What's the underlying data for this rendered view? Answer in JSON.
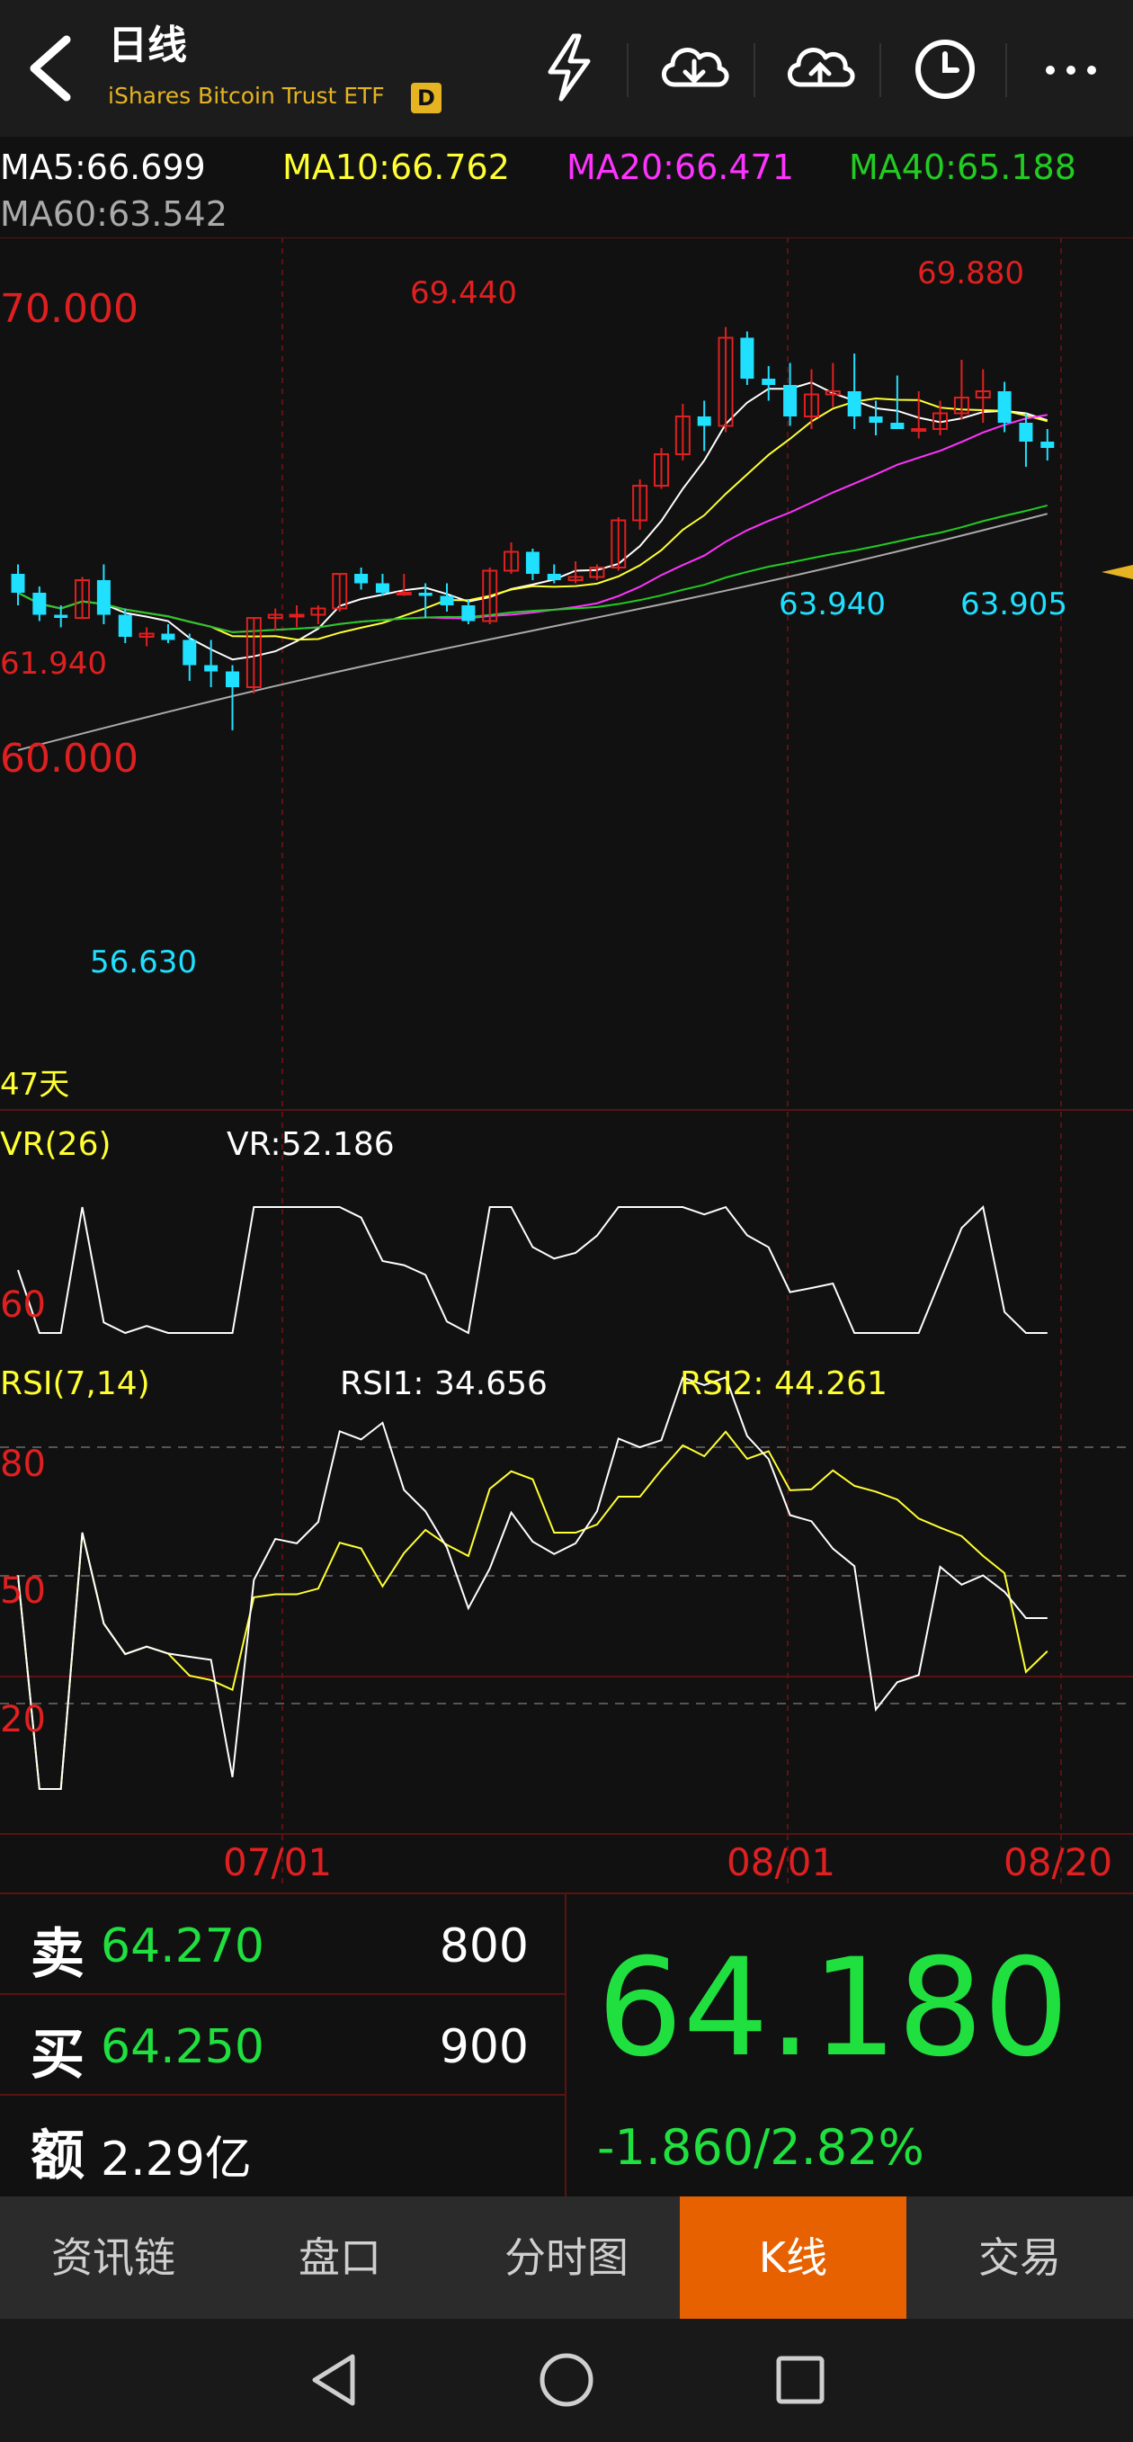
{
  "header": {
    "title": "日线",
    "subtitle": "iShares Bitcoin Trust ETF",
    "badge": "D",
    "icons": [
      "back-arrow-icon",
      "lightning-icon",
      "cloud-download-icon",
      "cloud-upload-icon",
      "clock-icon",
      "more-icon"
    ]
  },
  "ma_legend": [
    {
      "label": "MA5:66.699",
      "color": "#ffffff"
    },
    {
      "label": "MA10:66.762",
      "color": "#ffff33"
    },
    {
      "label": "MA20:66.471",
      "color": "#ff33ff"
    },
    {
      "label": "MA40:65.188",
      "color": "#22cc22"
    },
    {
      "label": "MA60:63.542",
      "color": "#aaaaaa"
    }
  ],
  "price_labels": {
    "y70": "70.000",
    "y60": "60.000",
    "high1": "69.440",
    "high2": "69.880",
    "low_left": "61.940",
    "low1": "56.630",
    "low2": "63.940",
    "low3": "63.905",
    "days": "47天"
  },
  "vr": {
    "title": "VR(26)",
    "value_label": "VR:52.186",
    "level": "60"
  },
  "rsi": {
    "title": "RSI(7,14)",
    "rsi1_label": "RSI1: 34.656",
    "rsi2_label": "RSI2: 44.261",
    "levels": [
      "80",
      "50",
      "20"
    ]
  },
  "dates": [
    "07/01",
    "08/01",
    "08/20"
  ],
  "quote": {
    "sell_key": "卖",
    "sell_price": "64.270",
    "sell_qty": "800",
    "buy_key": "买",
    "buy_price": "64.250",
    "buy_qty": "900",
    "amount_key": "额",
    "amount": "2.29亿",
    "last": "64.180",
    "change": "-1.860/2.82%"
  },
  "tabs": [
    {
      "label": "资讯链",
      "active": false
    },
    {
      "label": "盘口",
      "active": false
    },
    {
      "label": "分时图",
      "active": false
    },
    {
      "label": "K线",
      "active": true
    },
    {
      "label": "交易",
      "active": false
    }
  ],
  "colors": {
    "up": "#e02020",
    "down": "#20e0ff",
    "accent": "#e86100",
    "green": "#20e040",
    "grid": "#5a1212"
  },
  "chart_data": {
    "type": "candlestick",
    "candles": [
      [
        61.6,
        61.9,
        60.6,
        61.0
      ],
      [
        61.0,
        61.2,
        60.1,
        60.3
      ],
      [
        60.3,
        60.6,
        59.9,
        60.2
      ],
      [
        60.2,
        61.5,
        60.2,
        61.4
      ],
      [
        61.4,
        61.9,
        60.0,
        60.3
      ],
      [
        60.3,
        60.5,
        59.4,
        59.6
      ],
      [
        59.6,
        59.9,
        59.3,
        59.7
      ],
      [
        59.7,
        60.0,
        59.4,
        59.5
      ],
      [
        59.5,
        59.7,
        58.2,
        58.7
      ],
      [
        58.7,
        59.5,
        58.0,
        58.5
      ],
      [
        58.5,
        58.7,
        56.63,
        58.0
      ],
      [
        58.0,
        60.2,
        57.8,
        60.2
      ],
      [
        60.2,
        60.5,
        59.8,
        60.3
      ],
      [
        60.3,
        60.6,
        59.9,
        60.3
      ],
      [
        60.3,
        60.6,
        60.0,
        60.5
      ],
      [
        60.5,
        61.6,
        60.4,
        61.6
      ],
      [
        61.6,
        61.8,
        61.1,
        61.3
      ],
      [
        61.3,
        61.6,
        60.9,
        61.0
      ],
      [
        61.0,
        61.6,
        60.9,
        61.0
      ],
      [
        61.0,
        61.3,
        60.2,
        60.9
      ],
      [
        60.9,
        61.3,
        60.4,
        60.6
      ],
      [
        60.6,
        60.8,
        60.0,
        60.1
      ],
      [
        60.1,
        61.8,
        60.0,
        61.7
      ],
      [
        61.7,
        62.6,
        61.6,
        62.3
      ],
      [
        62.3,
        62.4,
        61.4,
        61.6
      ],
      [
        61.6,
        61.9,
        61.3,
        61.4
      ],
      [
        61.4,
        62.0,
        61.3,
        61.5
      ],
      [
        61.5,
        61.9,
        61.4,
        61.8
      ],
      [
        61.8,
        63.4,
        61.7,
        63.3
      ],
      [
        63.3,
        64.6,
        63.0,
        64.4
      ],
      [
        64.4,
        65.6,
        64.3,
        65.4
      ],
      [
        65.4,
        67.0,
        65.2,
        66.6
      ],
      [
        66.6,
        67.1,
        65.5,
        66.3
      ],
      [
        66.3,
        69.44,
        66.1,
        69.1
      ],
      [
        69.1,
        69.3,
        67.6,
        67.8
      ],
      [
        67.8,
        68.2,
        67.1,
        67.6
      ],
      [
        67.6,
        68.3,
        66.3,
        66.6
      ],
      [
        66.6,
        68.1,
        66.2,
        67.3
      ],
      [
        67.3,
        68.3,
        66.9,
        67.4
      ],
      [
        67.4,
        68.6,
        66.2,
        66.6
      ],
      [
        66.6,
        67.1,
        66.0,
        66.4
      ],
      [
        66.4,
        67.9,
        66.2,
        66.2
      ],
      [
        66.2,
        67.4,
        65.9,
        66.2
      ],
      [
        66.2,
        67.1,
        66.0,
        66.7
      ],
      [
        66.7,
        68.4,
        66.5,
        67.2
      ],
      [
        67.2,
        68.1,
        66.4,
        67.4
      ],
      [
        67.4,
        67.7,
        66.1,
        66.4
      ],
      [
        66.4,
        66.7,
        65.0,
        65.8
      ],
      [
        65.8,
        66.2,
        65.2,
        65.6
      ]
    ]
  }
}
